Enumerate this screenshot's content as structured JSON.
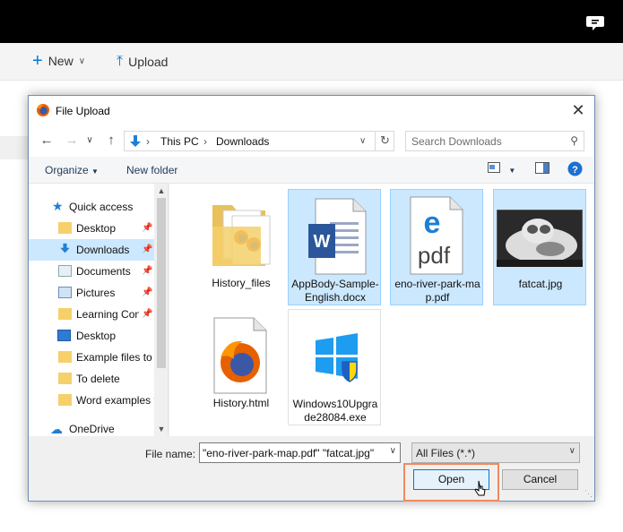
{
  "app": {
    "new_label": "New",
    "upload_label": "Upload"
  },
  "dialog": {
    "title": "File Upload",
    "breadcrumb": [
      "This PC",
      "Downloads"
    ],
    "search_placeholder": "Search Downloads",
    "toolbar": {
      "organize_label": "Organize",
      "new_folder_label": "New folder"
    },
    "sidebar": {
      "items": [
        {
          "label": "Quick access",
          "icon": "star-icon",
          "pinned": false
        },
        {
          "label": "Desktop",
          "icon": "folder-icon",
          "pinned": true
        },
        {
          "label": "Downloads",
          "icon": "download-arrow-icon",
          "pinned": true,
          "selected": true
        },
        {
          "label": "Documents",
          "icon": "documents-icon",
          "pinned": true
        },
        {
          "label": "Pictures",
          "icon": "pictures-icon",
          "pinned": true
        },
        {
          "label": "Learning Con",
          "icon": "folder-icon",
          "pinned": true
        },
        {
          "label": "Desktop",
          "icon": "desktop-icon",
          "pinned": false
        },
        {
          "label": "Example files to",
          "icon": "folder-icon",
          "pinned": false
        },
        {
          "label": "To delete",
          "icon": "folder-icon",
          "pinned": false
        },
        {
          "label": "Word examples f",
          "icon": "folder-icon",
          "pinned": false
        },
        {
          "label": "OneDrive",
          "icon": "cloud-icon",
          "pinned": false
        }
      ]
    },
    "files": [
      {
        "name": "History_files",
        "type": "folder",
        "selected": false
      },
      {
        "name": "AppBody-Sample-English.docx",
        "type": "word-doc",
        "selected": true
      },
      {
        "name": "eno-river-park-map.pdf",
        "type": "pdf",
        "selected": true
      },
      {
        "name": "fatcat.jpg",
        "type": "image",
        "selected": true
      },
      {
        "name": "History.html",
        "type": "firefox-html",
        "selected": false
      },
      {
        "name": "Windows10Upgrade28084.exe",
        "type": "exe",
        "selected": false
      }
    ],
    "file_name_label": "File name:",
    "file_name_value": "\"eno-river-park-map.pdf\" \"fatcat.jpg\"",
    "file_type_value": "All Files (*.*)",
    "open_label": "Open",
    "cancel_label": "Cancel"
  },
  "colors": {
    "selection": "#cce8ff",
    "highlight_box": "#f08a5d",
    "accent": "#0078d7"
  }
}
